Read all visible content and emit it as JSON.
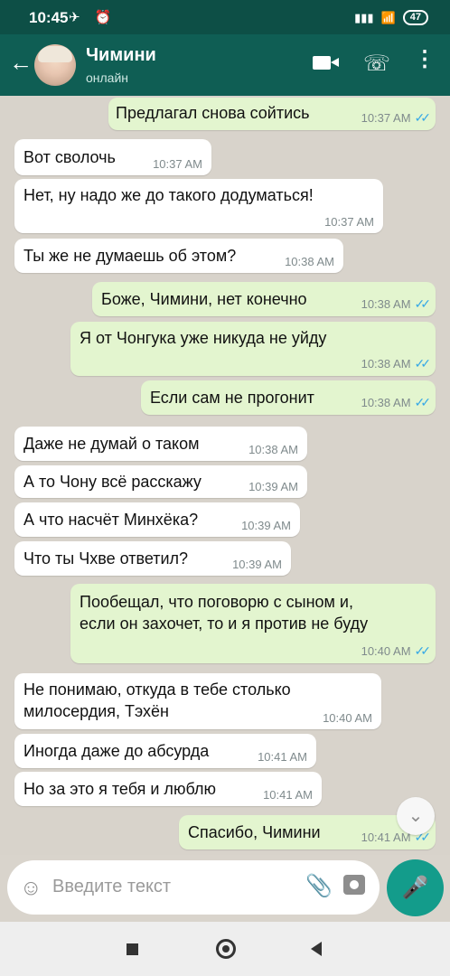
{
  "statusbar": {
    "time": "10:45",
    "icons": "✈ ⏰",
    "signal": "▮▮▮",
    "wifi": "📶",
    "battery": "47"
  },
  "header": {
    "title": "Чимини",
    "subtitle": "онлайн"
  },
  "messages": [
    {
      "dir": "out",
      "text": "Предлагал снова сойтись",
      "time": "10:37 AM"
    },
    {
      "dir": "in",
      "text": "Вот сволочь",
      "time": "10:37 AM"
    },
    {
      "dir": "in",
      "text": "Нет, ну надо же до такого додуматься!",
      "time": "10:37 AM"
    },
    {
      "dir": "in",
      "text": "Ты же не думаешь об этом?",
      "time": "10:38 AM"
    },
    {
      "dir": "out",
      "text": "Боже, Чимини, нет конечно",
      "time": "10:38 AM"
    },
    {
      "dir": "out",
      "text": "Я от Чонгука уже никуда не уйду",
      "time": "10:38 AM"
    },
    {
      "dir": "out",
      "text": "Если сам не прогонит",
      "time": "10:38 AM"
    },
    {
      "dir": "in",
      "text": "Даже не думай о таком",
      "time": "10:38 AM"
    },
    {
      "dir": "in",
      "text": "А то Чону всё расскажу",
      "time": "10:39 AM"
    },
    {
      "dir": "in",
      "text": "А что насчёт Минхёка?",
      "time": "10:39 AM"
    },
    {
      "dir": "in",
      "text": "Что ты Чхве ответил?",
      "time": "10:39 AM"
    },
    {
      "dir": "out",
      "text": "Пообещал, что поговорю с сыном и,\nесли он захочет, то и я против не буду",
      "time": "10:40 AM"
    },
    {
      "dir": "in",
      "text": "Не понимаю, откуда в тебе столько\nмилосердия, Тэхён",
      "time": "10:40 AM"
    },
    {
      "dir": "in",
      "text": "Иногда даже до абсурда",
      "time": "10:41 AM"
    },
    {
      "dir": "in",
      "text": "Но за это я тебя и люблю",
      "time": "10:41 AM"
    },
    {
      "dir": "out",
      "text": "Спасибо, Чимини",
      "time": "10:41 AM"
    }
  ],
  "composer": {
    "placeholder": "Введите текст"
  }
}
